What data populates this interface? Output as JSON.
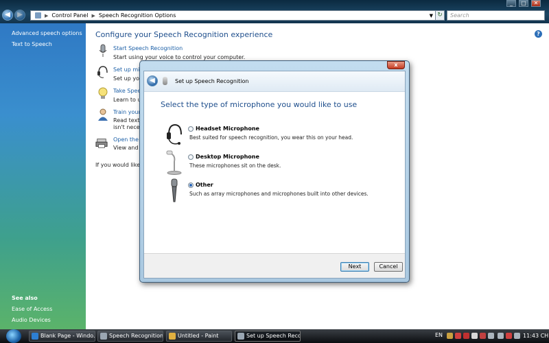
{
  "window": {
    "nav_back": "◀",
    "nav_forward": "▶",
    "breadcrumb": [
      "Control Panel",
      "Speech Recognition Options"
    ],
    "search_placeholder": "Search",
    "controls": [
      "_",
      "□",
      "✕"
    ]
  },
  "sidebar": {
    "links": [
      "Advanced speech options",
      "Text to Speech"
    ],
    "see_also_heading": "See also",
    "see_also_links": [
      "Ease of Access",
      "Audio Devices"
    ]
  },
  "content": {
    "title": "Configure your Speech Recognition experience",
    "tasks": [
      {
        "link": "Start Speech Recognition",
        "desc": [
          "Start using your voice to control your computer."
        ],
        "icon": "microphone-icon"
      },
      {
        "link": "Set up micr",
        "desc": [
          "Set up your"
        ],
        "icon": "headset-icon"
      },
      {
        "link": "Take Speec",
        "desc": [
          "Learn to use"
        ],
        "icon": "lightbulb-icon"
      },
      {
        "link": "Train your c",
        "desc": [
          "Read text to",
          "isn't necess"
        ],
        "icon": "person-icon"
      },
      {
        "link": "Open the Sp",
        "desc": [
          "View and pr"
        ],
        "icon": "printer-icon"
      }
    ],
    "footer_text": "If you would like to"
  },
  "dialog": {
    "title": "Set up Speech Recognition",
    "heading": "Select the type of microphone you would like to use",
    "options": [
      {
        "label": "Headset Microphone",
        "desc": "Best suited for speech recognition, you wear this on your head.",
        "checked": false,
        "icon": "headset-microphone-icon"
      },
      {
        "label": "Desktop Microphone",
        "desc": "These microphones sit on the desk.",
        "checked": false,
        "icon": "desktop-microphone-icon"
      },
      {
        "label": "Other",
        "desc": "Such as array microphones and microphones built into other devices.",
        "checked": true,
        "icon": "handheld-microphone-icon"
      }
    ],
    "next_label": "Next",
    "cancel_label": "Cancel",
    "close_label": "x"
  },
  "taskbar": {
    "items": [
      {
        "label": "Blank Page - Windo...",
        "icon_color": "#2d7fd3"
      },
      {
        "label": "Speech Recognition...",
        "icon_color": "#9aa6b2"
      },
      {
        "label": "Untitled - Paint",
        "icon_color": "#e0b040"
      },
      {
        "label": "Set up Speech Reco...",
        "icon_color": "#9aa6b2"
      }
    ],
    "language": "EN",
    "clock": "11:43 CH"
  }
}
